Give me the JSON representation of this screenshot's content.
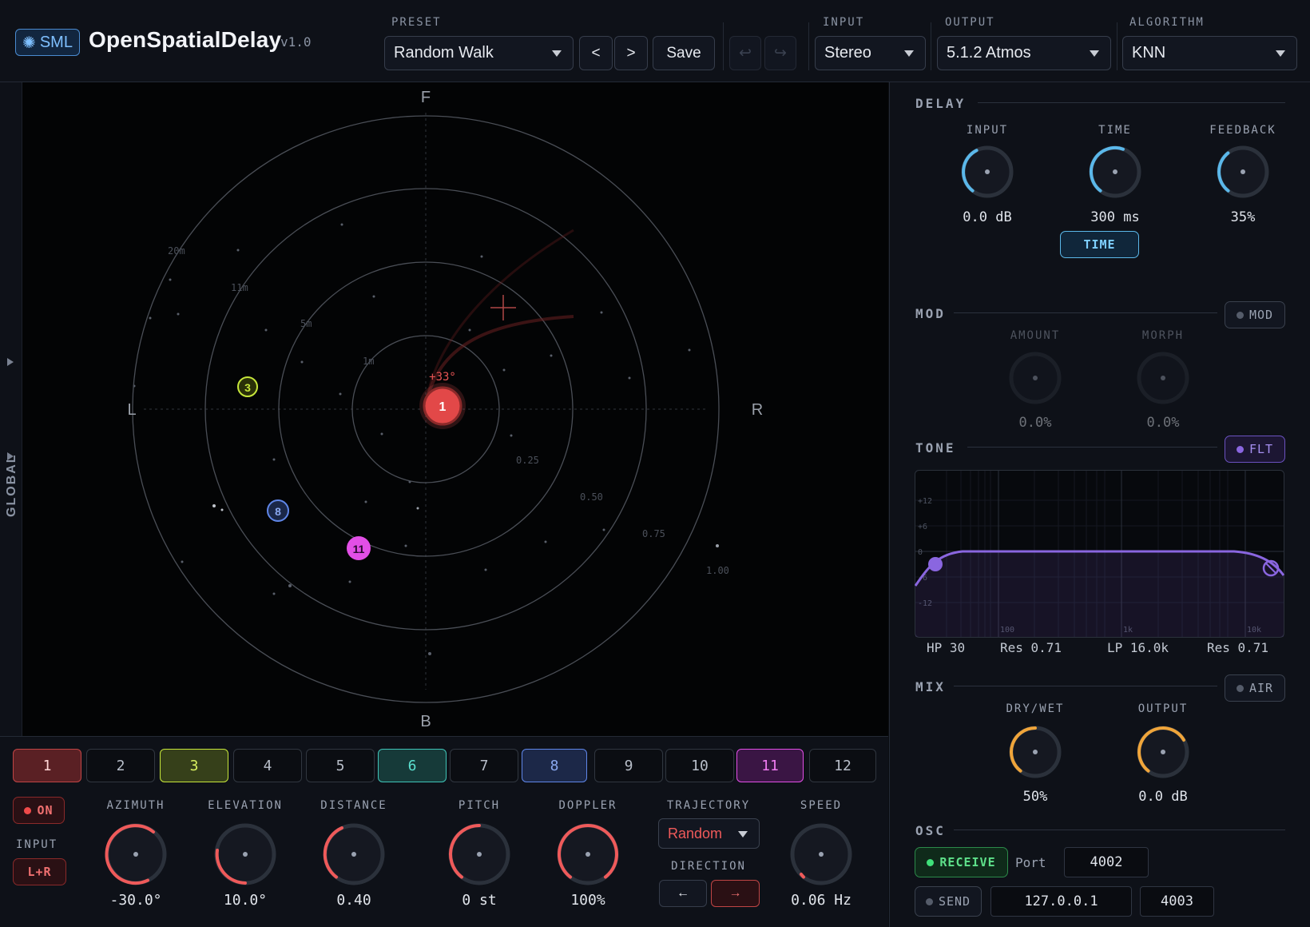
{
  "header": {
    "logo_text": "SML",
    "title": "OpenSpatialDelay",
    "version": "v1.0",
    "preset_label": "PRESET",
    "preset_value": "Random Walk",
    "prev_label": "<",
    "next_label": ">",
    "save_label": "Save",
    "undo_icon": "undo-icon",
    "redo_icon": "redo-icon",
    "input_label": "INPUT",
    "input_value": "Stereo",
    "output_label": "OUTPUT",
    "output_value": "5.1.2 Atmos",
    "algorithm_label": "ALGORITHM",
    "algorithm_value": "KNN"
  },
  "sidebar": {
    "global_label": "GLOBAL"
  },
  "space": {
    "front": "F",
    "back": "B",
    "left": "L",
    "right": "R",
    "distance_labels": [
      "20m",
      "11m",
      "5m",
      "1m"
    ],
    "radius_labels": [
      "0.25",
      "0.50",
      "0.75",
      "1.00"
    ],
    "selected_angle": "+33°",
    "sources": [
      {
        "id": "1",
        "color": "#ef5a5a",
        "selected": true
      },
      {
        "id": "3",
        "color": "#c6e63a"
      },
      {
        "id": "8",
        "color": "#5f86e8"
      },
      {
        "id": "11",
        "color": "#e24fe6"
      }
    ]
  },
  "delay": {
    "title": "DELAY",
    "input_label": "INPUT",
    "input_value": "0.0 dB",
    "time_label": "TIME",
    "time_value": "300 ms",
    "feedback_label": "FEEDBACK",
    "feedback_value": "35%",
    "time_button": "TIME",
    "accent": "#5bb8ea"
  },
  "mod": {
    "title": "MOD",
    "toggle": "MOD",
    "amount_label": "AMOUNT",
    "amount_value": "0.0%",
    "morph_label": "MORPH",
    "morph_value": "0.0%"
  },
  "tone": {
    "title": "TONE",
    "toggle": "FLT",
    "db_ticks": [
      "+12",
      "+6",
      "0",
      "-6",
      "-12"
    ],
    "freq_ticks": [
      "100",
      "1k",
      "10k"
    ],
    "hp_label": "HP 30",
    "hp_res": "Res 0.71",
    "lp_label": "LP 16.0k",
    "lp_res": "Res 0.71",
    "accent": "#8a66e0"
  },
  "mix": {
    "title": "MIX",
    "toggle": "AIR",
    "drywet_label": "DRY/WET",
    "drywet_value": "50%",
    "output_label": "OUTPUT",
    "output_value": "0.0 dB",
    "accent": "#f0a53a"
  },
  "osc": {
    "title": "OSC",
    "receive_label": "RECEIVE",
    "port_label": "Port",
    "port_value": "4002",
    "send_label": "SEND",
    "send_ip": "127.0.0.1",
    "send_port": "4003"
  },
  "channels": [
    {
      "label": "1",
      "color": "#ef5a5a",
      "active": true
    },
    {
      "label": "2"
    },
    {
      "label": "3",
      "color": "#c6e63a",
      "active": true
    },
    {
      "label": "4"
    },
    {
      "label": "5"
    },
    {
      "label": "6",
      "color": "#3fc4b8",
      "active": true
    },
    {
      "label": "7"
    },
    {
      "label": "8",
      "color": "#5f86e8",
      "active": true
    },
    {
      "label": "9"
    },
    {
      "label": "10"
    },
    {
      "label": "11",
      "color": "#e24fe6",
      "active": true
    },
    {
      "label": "12"
    }
  ],
  "source_controls": {
    "on_label": "ON",
    "input_label": "INPUT",
    "input_value": "L+R",
    "azimuth_label": "AZIMUTH",
    "azimuth_value": "-30.0°",
    "elevation_label": "ELEVATION",
    "elevation_value": "10.0°",
    "distance_label": "DISTANCE",
    "distance_value": "0.40",
    "pitch_label": "PITCH",
    "pitch_value": "0 st",
    "doppler_label": "DOPPLER",
    "doppler_value": "100%",
    "trajectory_label": "TRAJECTORY",
    "trajectory_value": "Random",
    "direction_label": "DIRECTION",
    "dir_left": "←",
    "dir_right": "→",
    "speed_label": "SPEED",
    "speed_value": "0.06 Hz",
    "accent": "#ef5a5a"
  }
}
